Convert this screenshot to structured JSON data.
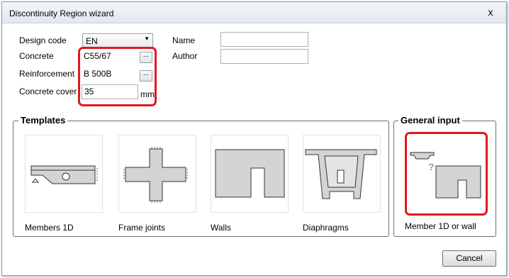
{
  "window": {
    "title": "Discontinuity Region wizard",
    "close_glyph": "x"
  },
  "form": {
    "design_code": {
      "label": "Design code",
      "value": "EN"
    },
    "concrete": {
      "label": "Concrete",
      "value": "C55/67",
      "button": "..."
    },
    "reinforcement": {
      "label": "Reinforcement",
      "value": "B 500B",
      "button": "..."
    },
    "concrete_cover": {
      "label": "Concrete cover",
      "value": "35",
      "unit": "mm"
    },
    "name": {
      "label": "Name",
      "value": ""
    },
    "author": {
      "label": "Author",
      "value": ""
    }
  },
  "templates": {
    "title": "Templates",
    "items": [
      {
        "label": "Members 1D",
        "icon": "member-1d-icon"
      },
      {
        "label": "Frame joints",
        "icon": "frame-joint-icon"
      },
      {
        "label": "Walls",
        "icon": "wall-icon"
      },
      {
        "label": "Diaphragms",
        "icon": "diaphragm-icon"
      }
    ]
  },
  "general_input": {
    "title": "General input",
    "item": {
      "label": "Member 1D or wall",
      "icon": "member-or-wall-icon"
    }
  },
  "footer": {
    "cancel_label": "Cancel"
  },
  "colors": {
    "highlight": "#e0191f",
    "shape_fill": "#d4d4d4",
    "shape_stroke": "#333333"
  }
}
